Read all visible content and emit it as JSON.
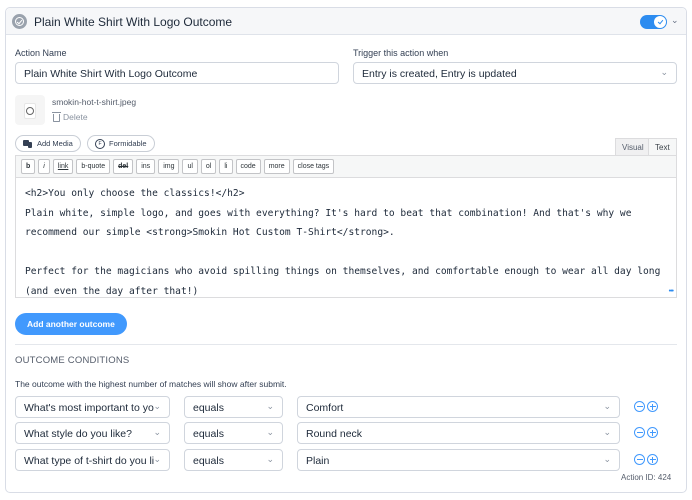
{
  "header": {
    "title": "Plain White Shirt With Logo Outcome",
    "status_icon": "check-circle-icon",
    "toggle_on": true,
    "expand_icon": "chevron-down-icon"
  },
  "action_name": {
    "label": "Action Name",
    "value": "Plain White Shirt With Logo Outcome"
  },
  "trigger": {
    "label": "Trigger this action when",
    "value": "Entry is created, Entry is updated"
  },
  "attachment": {
    "file_name": "smokin-hot-t-shirt.jpeg",
    "delete_label": "Delete"
  },
  "media_buttons": {
    "add_media": "Add Media",
    "formidable": "Formidable"
  },
  "editor_tabs": {
    "visual": "Visual",
    "text": "Text",
    "active": "Text"
  },
  "quicktags": [
    "b",
    "i",
    "link",
    "b-quote",
    "del",
    "ins",
    "img",
    "ul",
    "ol",
    "li",
    "code",
    "more",
    "close tags"
  ],
  "editor_content": "<h2>You only choose the classics!</h2>\nPlain white, simple logo, and goes with everything? It's hard to beat that combination! And that's why we\nrecommend our simple <strong>Smokin Hot Custom T-Shirt</strong>.\n\nPerfect for the magicians who avoid spilling things on themselves, and comfortable enough to wear all day long\n(and even the day after that!)",
  "add_outcome_label": "Add another outcome",
  "conditions": {
    "title": "OUTCOME CONDITIONS",
    "help": "The outcome with the highest number of matches will show after submit.",
    "rows": [
      {
        "field": "What's most important to yo",
        "operator": "equals",
        "value": "Comfort"
      },
      {
        "field": "What style do you like?",
        "operator": "equals",
        "value": "Round neck"
      },
      {
        "field": "What type of t-shirt do you li",
        "operator": "equals",
        "value": "Plain"
      }
    ]
  },
  "action_id": "Action ID: 424",
  "colors": {
    "accent": "#4199fd",
    "toggle": "#2d8cf0"
  }
}
